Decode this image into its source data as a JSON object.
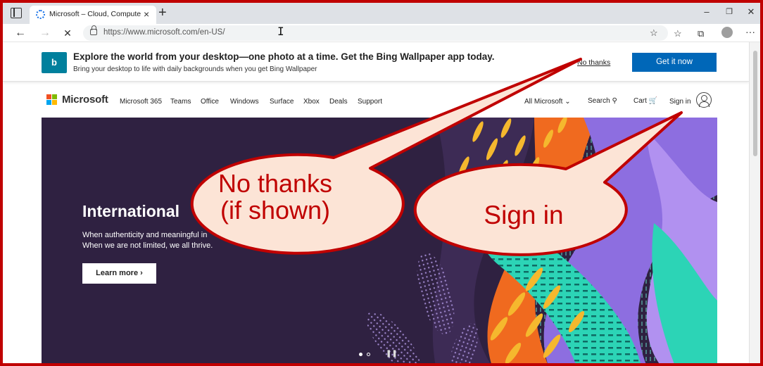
{
  "browser": {
    "tab_title": "Microsoft – Cloud, Computers, A",
    "url": "https://www.microsoft.com/en-US/",
    "win_minimize": "–",
    "win_restore": "❐",
    "win_close": "✕"
  },
  "banner": {
    "logo_text": "b",
    "title": "Explore the world from your desktop—one photo at a time. Get the Bing Wallpaper app today.",
    "subtitle": "Bring your desktop to life with daily backgrounds when you get Bing Wallpaper",
    "no_thanks": "No thanks",
    "get_it_now": "Get it now"
  },
  "ms_nav": {
    "wordmark": "Microsoft",
    "links": [
      "Microsoft 365",
      "Teams",
      "Office",
      "Windows",
      "Surface",
      "Xbox",
      "Deals",
      "Support"
    ],
    "all_microsoft": "All Microsoft ⌄",
    "search": "Search ⚲",
    "cart": "Cart 🛒",
    "sign_in": "Sign in"
  },
  "hero": {
    "heading": "International",
    "body_line1": "When authenticity and meaningful in",
    "body_line2": "When we are not limited, we all thrive.",
    "learn_more": "Learn more ›"
  },
  "callouts": {
    "no_thanks_line1": "No thanks",
    "no_thanks_line2": "(if shown)",
    "sign_in": "Sign in"
  },
  "colors": {
    "callout_border": "#c00000",
    "callout_fill": "#fce4d6",
    "accent_blue": "#0067b8",
    "hero_bg": "#2f2141"
  },
  "icons": [
    "tab-actions-icon",
    "back-arrow-icon",
    "forward-arrow-icon",
    "stop-loading-icon",
    "lock-icon",
    "favorite-add-icon",
    "favorites-icon",
    "collections-icon",
    "profile-icon",
    "more-icon",
    "search-icon",
    "cart-icon",
    "account-icon"
  ]
}
